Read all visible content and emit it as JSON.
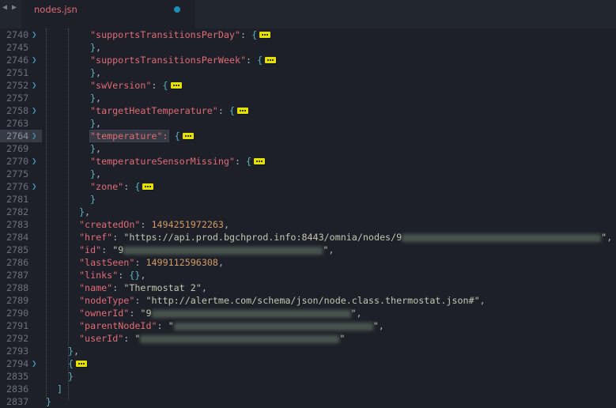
{
  "tab": {
    "title": "nodes.jsn",
    "modified": true
  },
  "nav": {
    "back": "◀",
    "forward": "▶"
  },
  "fold_glyph": "❯",
  "lines": [
    {
      "num": "2740",
      "fold": true,
      "indent": 4,
      "tokens": [
        [
          "k",
          "\"supportsTransitionsPerDay\""
        ],
        [
          "p",
          ": "
        ],
        [
          "b",
          "{"
        ],
        [
          "ell",
          ""
        ]
      ]
    },
    {
      "num": "2745",
      "indent": 4,
      "tokens": [
        [
          "b",
          "}"
        ],
        [
          "p",
          ","
        ]
      ]
    },
    {
      "num": "2746",
      "fold": true,
      "indent": 4,
      "tokens": [
        [
          "k",
          "\"supportsTransitionsPerWeek\""
        ],
        [
          "p",
          ": "
        ],
        [
          "b",
          "{"
        ],
        [
          "ell",
          ""
        ]
      ]
    },
    {
      "num": "2751",
      "indent": 4,
      "tokens": [
        [
          "b",
          "}"
        ],
        [
          "p",
          ","
        ]
      ]
    },
    {
      "num": "2752",
      "fold": true,
      "indent": 4,
      "tokens": [
        [
          "k",
          "\"swVersion\""
        ],
        [
          "p",
          ": "
        ],
        [
          "b",
          "{"
        ],
        [
          "ell",
          ""
        ]
      ]
    },
    {
      "num": "2757",
      "indent": 4,
      "tokens": [
        [
          "b",
          "}"
        ],
        [
          "p",
          ","
        ]
      ]
    },
    {
      "num": "2758",
      "fold": true,
      "indent": 4,
      "tokens": [
        [
          "k",
          "\"targetHeatTemperature\""
        ],
        [
          "p",
          ": "
        ],
        [
          "b",
          "{"
        ],
        [
          "ell",
          ""
        ]
      ]
    },
    {
      "num": "2763",
      "indent": 4,
      "tokens": [
        [
          "b",
          "}"
        ],
        [
          "p",
          ","
        ]
      ]
    },
    {
      "num": "2764",
      "fold": true,
      "indent": 4,
      "current": true,
      "tokens": [
        [
          "sel",
          "\"temperature\":"
        ],
        [
          "cursor",
          ""
        ],
        [
          "p",
          " "
        ],
        [
          "b",
          "{"
        ],
        [
          "ell",
          ""
        ]
      ]
    },
    {
      "num": "2769",
      "indent": 4,
      "tokens": [
        [
          "b",
          "}"
        ],
        [
          "p",
          ","
        ]
      ]
    },
    {
      "num": "2770",
      "fold": true,
      "indent": 4,
      "tokens": [
        [
          "k",
          "\"temperatureSensorMissing\""
        ],
        [
          "p",
          ": "
        ],
        [
          "b",
          "{"
        ],
        [
          "ell",
          ""
        ]
      ]
    },
    {
      "num": "2775",
      "indent": 4,
      "tokens": [
        [
          "b",
          "}"
        ],
        [
          "p",
          ","
        ]
      ]
    },
    {
      "num": "2776",
      "fold": true,
      "indent": 4,
      "tokens": [
        [
          "k",
          "\"zone\""
        ],
        [
          "p",
          ": "
        ],
        [
          "b",
          "{"
        ],
        [
          "ell",
          ""
        ]
      ]
    },
    {
      "num": "2781",
      "indent": 4,
      "tokens": [
        [
          "b",
          "}"
        ]
      ]
    },
    {
      "num": "2782",
      "indent": 3,
      "tokens": [
        [
          "b",
          "}"
        ],
        [
          "p",
          ","
        ]
      ]
    },
    {
      "num": "2783",
      "indent": 3,
      "tokens": [
        [
          "k",
          "\"createdOn\""
        ],
        [
          "p",
          ": "
        ],
        [
          "n",
          "1494251972263"
        ],
        [
          "p",
          ","
        ]
      ]
    },
    {
      "num": "2784",
      "indent": 3,
      "tokens": [
        [
          "k",
          "\"href\""
        ],
        [
          "p",
          ": "
        ],
        [
          "s",
          "\"https://api.prod.bgchprod.info:8443/omnia/nodes/9"
        ],
        [
          "blur",
          "36"
        ],
        [
          "s",
          "\""
        ],
        [
          "p",
          ","
        ]
      ]
    },
    {
      "num": "2785",
      "indent": 3,
      "tokens": [
        [
          "k",
          "\"id\""
        ],
        [
          "p",
          ": "
        ],
        [
          "s",
          "\"9"
        ],
        [
          "blur",
          "36"
        ],
        [
          "s",
          "\""
        ],
        [
          "p",
          ","
        ]
      ]
    },
    {
      "num": "2786",
      "indent": 3,
      "tokens": [
        [
          "k",
          "\"lastSeen\""
        ],
        [
          "p",
          ": "
        ],
        [
          "n",
          "1499112596308"
        ],
        [
          "p",
          ","
        ]
      ]
    },
    {
      "num": "2787",
      "indent": 3,
      "tokens": [
        [
          "k",
          "\"links\""
        ],
        [
          "p",
          ": "
        ],
        [
          "b",
          "{}"
        ],
        [
          "p",
          ","
        ]
      ]
    },
    {
      "num": "2788",
      "indent": 3,
      "tokens": [
        [
          "k",
          "\"name\""
        ],
        [
          "p",
          ": "
        ],
        [
          "s",
          "\"Thermostat 2\""
        ],
        [
          "p",
          ","
        ]
      ]
    },
    {
      "num": "2789",
      "indent": 3,
      "tokens": [
        [
          "k",
          "\"nodeType\""
        ],
        [
          "p",
          ": "
        ],
        [
          "s",
          "\"http://alertme.com/schema/json/node.class.thermostat.json#\""
        ],
        [
          "p",
          ","
        ]
      ]
    },
    {
      "num": "2790",
      "indent": 3,
      "tokens": [
        [
          "k",
          "\"ownerId\""
        ],
        [
          "p",
          ": "
        ],
        [
          "s",
          "\"9"
        ],
        [
          "blur",
          "36"
        ],
        [
          "s",
          "\""
        ],
        [
          "p",
          ","
        ]
      ]
    },
    {
      "num": "2791",
      "indent": 3,
      "tokens": [
        [
          "k",
          "\"parentNodeId\""
        ],
        [
          "p",
          ": "
        ],
        [
          "s",
          "\""
        ],
        [
          "blur",
          "36"
        ],
        [
          "s",
          "\""
        ],
        [
          "p",
          ","
        ]
      ]
    },
    {
      "num": "2792",
      "indent": 3,
      "tokens": [
        [
          "k",
          "\"userId\""
        ],
        [
          "p",
          ": "
        ],
        [
          "s",
          "\""
        ],
        [
          "blur",
          "36"
        ],
        [
          "s",
          "\""
        ]
      ]
    },
    {
      "num": "2793",
      "indent": 2,
      "tokens": [
        [
          "b",
          "}"
        ],
        [
          "p",
          ","
        ]
      ]
    },
    {
      "num": "2794",
      "fold": true,
      "indent": 2,
      "tokens": [
        [
          "b",
          "{"
        ],
        [
          "ell",
          ""
        ]
      ]
    },
    {
      "num": "2835",
      "indent": 2,
      "tokens": [
        [
          "b",
          "}"
        ]
      ]
    },
    {
      "num": "2836",
      "indent": 1,
      "tokens": [
        [
          "b",
          "]"
        ]
      ]
    },
    {
      "num": "2837",
      "indent": 0,
      "tokens": [
        [
          "b",
          "}"
        ]
      ]
    }
  ]
}
